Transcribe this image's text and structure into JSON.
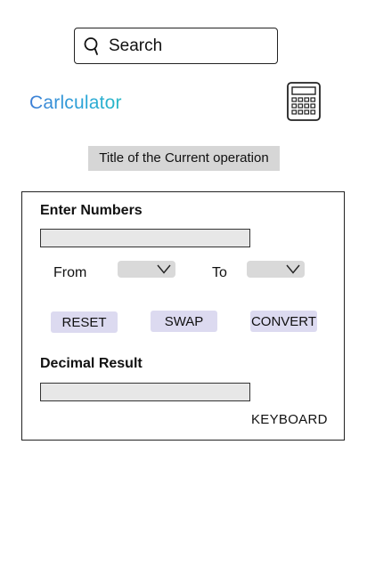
{
  "search": {
    "placeholder": "Search"
  },
  "app": {
    "title": "Carlculator"
  },
  "operation": {
    "title": "Title of the Current operation"
  },
  "converter": {
    "input_label": "Enter Numbers",
    "from_label": "From",
    "to_label": "To",
    "reset_label": "RESET",
    "swap_label": "SWAP",
    "convert_label": "CONVERT",
    "result_label": "Decimal Result",
    "keyboard_label": "KEYBOARD"
  },
  "colors": {
    "title_gradient_start": "#3f7fd6",
    "title_gradient_end": "#29b9c6",
    "button_bg": "#dcdaf0",
    "field_bg": "#e7e7e7",
    "dropdown_bg": "#d9d9d9",
    "operation_bg": "#d6d6d6"
  },
  "icons": {
    "search": "search-icon",
    "calculator": "calculator-icon",
    "dropdown": "chevron-down-icon"
  }
}
